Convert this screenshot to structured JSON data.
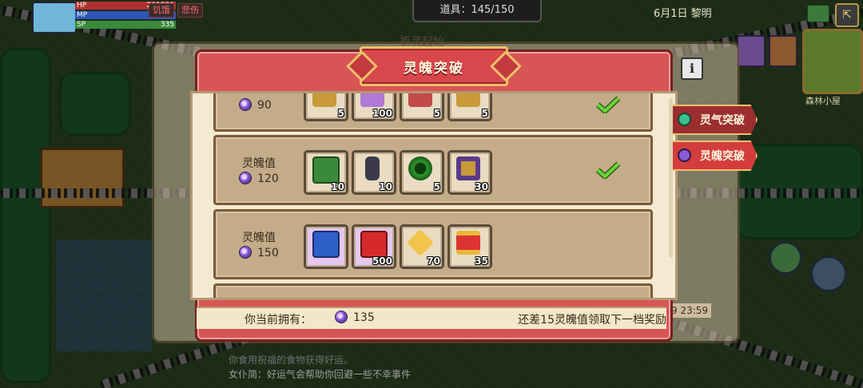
{
  "hud": {
    "hp_label": "HP",
    "hp_value": "261926",
    "mp_label": "MP",
    "mp_value": "31000",
    "sp_label": "SP",
    "sp_value": "335",
    "pill1": "饥饿",
    "pill2": "悲伤"
  },
  "topbar": {
    "items": "道具：145/150",
    "date": "6月1日 黎明"
  },
  "map": {
    "label": "森林小屋"
  },
  "behind": {
    "title": "祈灵起始",
    "time": "9 23:59"
  },
  "modal": {
    "title": "灵魄突破",
    "info": "i",
    "rows": [
      {
        "name": "",
        "value": "90",
        "items": [
          {
            "icon": "gold-item-icon",
            "count": "5"
          },
          {
            "icon": "purple-item-icon",
            "count": "100"
          },
          {
            "icon": "red-item-icon",
            "count": "5"
          },
          {
            "icon": "gold-item-icon",
            "count": "5"
          }
        ],
        "claimed": true
      },
      {
        "name": "灵魄值",
        "value": "120",
        "items": [
          {
            "icon": "green-book-icon",
            "count": "10"
          },
          {
            "icon": "bottle-icon",
            "count": "10"
          },
          {
            "icon": "green-ring-icon",
            "count": "5"
          },
          {
            "icon": "purple-box-icon",
            "count": "30"
          }
        ],
        "claimed": true
      },
      {
        "name": "灵魄值",
        "value": "150",
        "items": [
          {
            "icon": "blue-potion-book-icon",
            "count": ""
          },
          {
            "icon": "red-brick-icon",
            "count": "500"
          },
          {
            "icon": "gold-crystal-icon",
            "count": "70"
          },
          {
            "icon": "hourglass-icon",
            "count": "35"
          }
        ],
        "claimed": false
      }
    ],
    "footer": {
      "own_label": "你当前拥有：",
      "own_value": "135",
      "hint": "还差15灵魄值领取下一档奖励"
    }
  },
  "tabs": [
    {
      "label": "灵气突破",
      "color": "#3fbf8f"
    },
    {
      "label": "灵魄突破",
      "color": "#8a5cd6"
    }
  ],
  "log": {
    "line1": "你食用祝福的食物获得好运。",
    "line2": "女仆简：好运气会帮助你回避一些不幸事件"
  },
  "colors": {
    "accent": "#d85555",
    "panel": "#f4ead2",
    "check": "#6cd33a"
  }
}
